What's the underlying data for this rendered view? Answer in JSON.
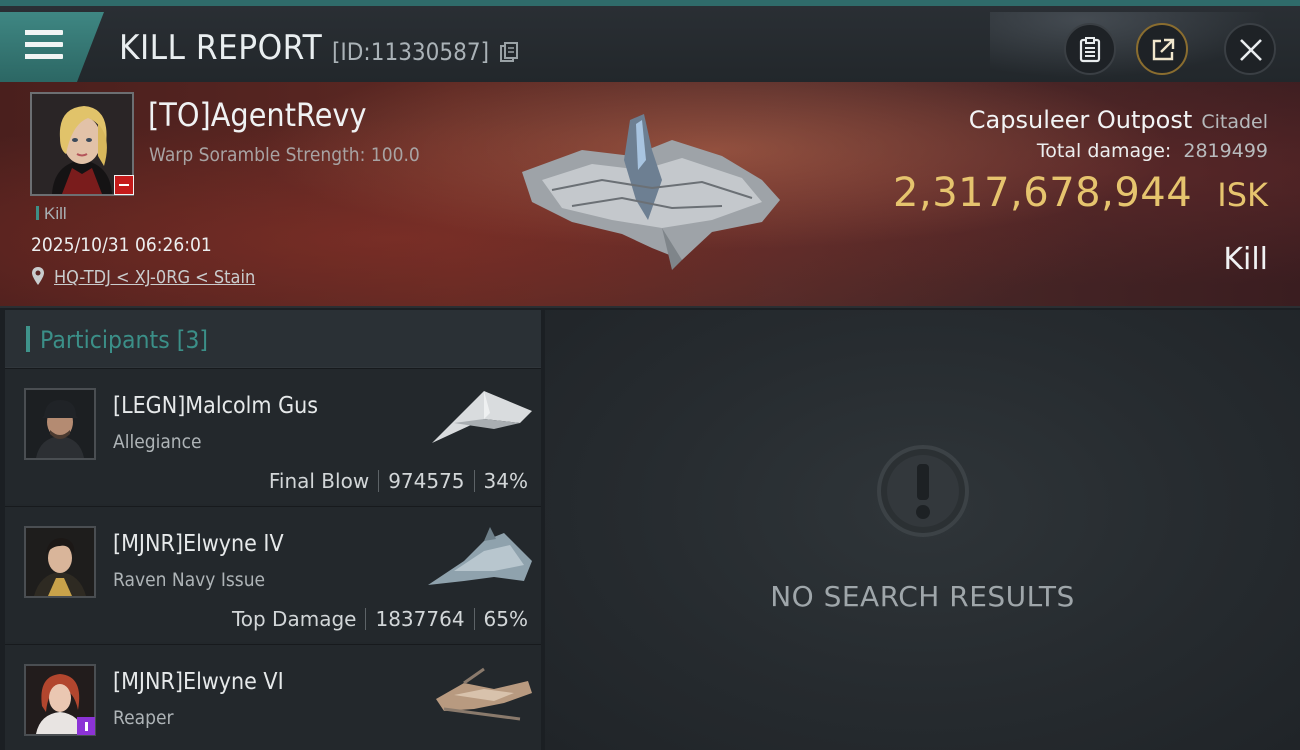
{
  "header": {
    "title": "KILL REPORT",
    "report_id": "[ID:11330587]"
  },
  "victim": {
    "name": "[TO]AgentRevy",
    "subline": "Warp Soramble Strength: 100.0",
    "tag": "Kill",
    "timestamp": "2025/10/31 06:26:01",
    "location": "HQ-TDJ < XJ-0RG < Stain"
  },
  "target": {
    "name": "Capsuleer Outpost",
    "type": "Citadel",
    "total_damage_label": "Total damage:",
    "total_damage_value": "2819499",
    "isk_value": "2,317,678,944",
    "isk_unit": "ISK",
    "result": "Kill"
  },
  "participants": {
    "title": "Participants [3]",
    "items": [
      {
        "name": "[LEGN]Malcolm Gus",
        "ship": "Allegiance",
        "role": "Final Blow",
        "damage": "974575",
        "percent": "34%"
      },
      {
        "name": "[MJNR]Elwyne IV",
        "ship": "Raven Navy Issue",
        "role": "Top Damage",
        "damage": "1837764",
        "percent": "65%"
      },
      {
        "name": "[MJNR]Elwyne VI",
        "ship": "Reaper",
        "role": "",
        "damage": "",
        "percent": ""
      }
    ]
  },
  "results": {
    "empty_text": "NO SEARCH RESULTS"
  },
  "colors": {
    "accent_teal": "#3f938b",
    "isk_gold": "#e6c46e",
    "banner_red": "#5c2823",
    "badge_red": "#c41b1b",
    "badge_purple": "#8c33d6"
  },
  "icons": {
    "menu": "hamburger-menu-icon",
    "copy": "copy-icon",
    "clipboard": "clipboard-icon",
    "share": "share-external-icon",
    "close": "close-x-icon",
    "location": "map-pin-icon",
    "empty": "exclamation-circle-icon"
  }
}
